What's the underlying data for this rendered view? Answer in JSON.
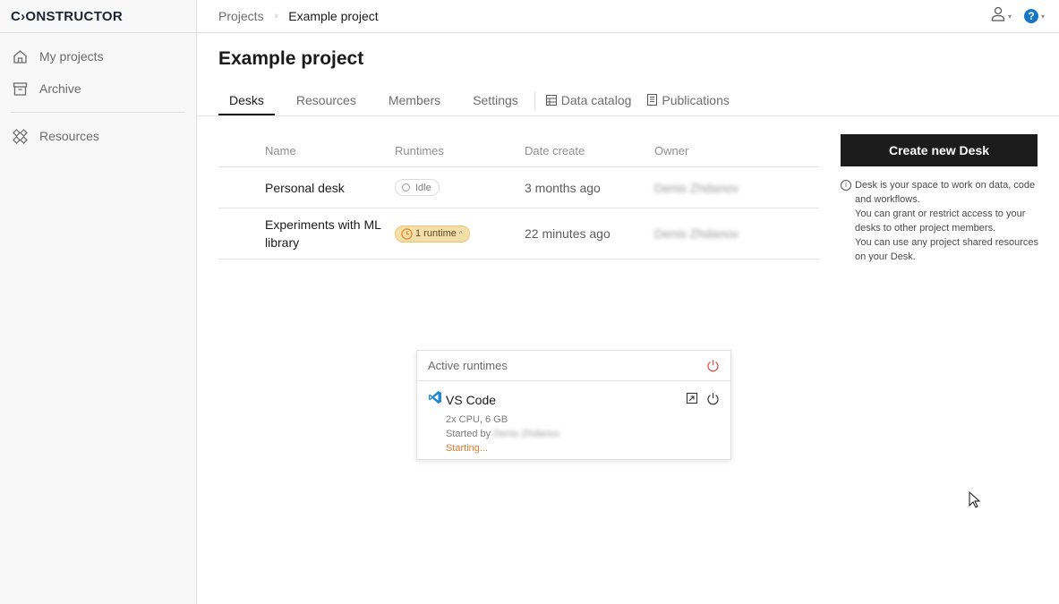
{
  "brand": {
    "name": "C›ONSTRUCTOR"
  },
  "sidebar": {
    "items": [
      {
        "label": "My projects",
        "icon": "home-icon"
      },
      {
        "label": "Archive",
        "icon": "archive-icon"
      },
      {
        "label": "Resources",
        "icon": "resources-icon"
      }
    ]
  },
  "breadcrumb": {
    "parent": "Projects",
    "current": "Example project"
  },
  "header": {
    "user_icon": "user-icon",
    "help_label": "?"
  },
  "page": {
    "title": "Example project"
  },
  "tabs": [
    {
      "label": "Desks",
      "active": true
    },
    {
      "label": "Resources"
    },
    {
      "label": "Members"
    },
    {
      "label": "Settings"
    },
    {
      "label": "Data catalog",
      "icon": "table-icon"
    },
    {
      "label": "Publications",
      "icon": "document-icon"
    }
  ],
  "table": {
    "columns": [
      "Name",
      "Runtimes",
      "Date create",
      "Owner"
    ],
    "rows": [
      {
        "name": "Personal desk",
        "runtime": "Idle",
        "date": "3 months ago",
        "owner": "Denis Zhdanov"
      },
      {
        "name": "Experiments with ML library",
        "runtime": "1 runtime",
        "date": "22 minutes ago",
        "owner": "Denis Zhdanov"
      }
    ]
  },
  "popover": {
    "title": "Active runtimes",
    "runtimes": [
      {
        "name": "VS Code",
        "specs": "2x CPU, 6 GB",
        "started_by_label": "Started by",
        "started_by": "Denis Zhdanov",
        "status": "Starting..."
      }
    ]
  },
  "right_panel": {
    "create_button": "Create new Desk",
    "hint_lines": [
      "Desk is your space to work on data, code and workflows.",
      "You can grant or restrict access to your desks to other project members.",
      "You can use any project shared resources on your Desk."
    ]
  },
  "colors": {
    "accent_dark": "#1c1c1c",
    "help_blue": "#1577c6",
    "runtime_pill_bg": "#f3dfa9",
    "status_starting": "#e07b2e",
    "stop_red": "#e0544b",
    "vscode_blue": "#1f8ad2"
  }
}
